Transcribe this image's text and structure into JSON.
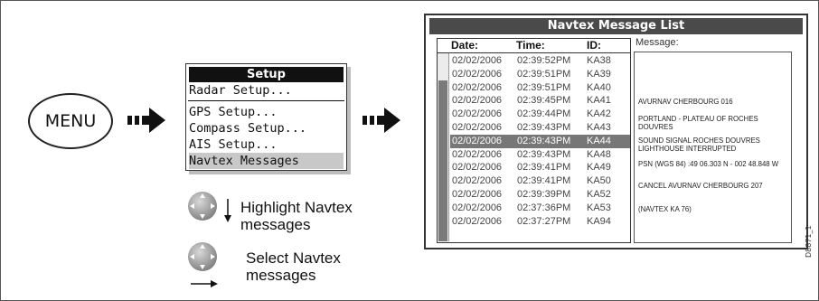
{
  "menu_key": {
    "label": "MENU"
  },
  "setup_menu": {
    "title": "Setup",
    "items": [
      {
        "label": "Radar Setup..."
      },
      {
        "label": "GPS Setup..."
      },
      {
        "label": "Compass Setup..."
      },
      {
        "label": "AIS Setup..."
      },
      {
        "label": "Navtex Messages",
        "selected": true
      }
    ]
  },
  "navtex": {
    "title": "Navtex Message List",
    "columns": {
      "date": "Date:",
      "time": "Time:",
      "id": "ID:"
    },
    "message_label": "Message:",
    "rows": [
      {
        "date": "02/02/2006",
        "time": "02:39:52PM",
        "id": "KA38"
      },
      {
        "date": "02/02/2006",
        "time": "02:39:51PM",
        "id": "KA39"
      },
      {
        "date": "02/02/2006",
        "time": "02:39:51PM",
        "id": "KA40"
      },
      {
        "date": "02/02/2006",
        "time": "02:39:45PM",
        "id": "KA41"
      },
      {
        "date": "02/02/2006",
        "time": "02:39:44PM",
        "id": "KA42"
      },
      {
        "date": "02/02/2006",
        "time": "02:39:43PM",
        "id": "KA43"
      },
      {
        "date": "02/02/2006",
        "time": "02:39:43PM",
        "id": "KA44",
        "selected": true
      },
      {
        "date": "02/02/2006",
        "time": "02:39:43PM",
        "id": "KA48"
      },
      {
        "date": "02/02/2006",
        "time": "02:39:41PM",
        "id": "KA49"
      },
      {
        "date": "02/02/2006",
        "time": "02:39:41PM",
        "id": "KA50"
      },
      {
        "date": "02/02/2006",
        "time": "02:39:39PM",
        "id": "KA52"
      },
      {
        "date": "02/02/2006",
        "time": "02:37:36PM",
        "id": "KA53"
      },
      {
        "date": "02/02/2006",
        "time": "02:37:27PM",
        "id": "KA94"
      }
    ],
    "message_lines": [
      "AVURNAV CHERBOURG 016",
      "PORTLAND - PLATEAU OF ROCHES DOUVRES",
      "SOUND SIGNAL ROCHES DOUVRES LIGHTHOUSE INTERRUPTED",
      "PSN (WGS 84) :49 06.303 N - 002 48.848 W",
      "CANCEL AVURNAV CHERBOURG 207",
      "(NAVTEX KA 76)"
    ]
  },
  "instructions": {
    "highlight": {
      "line1": "Highlight Navtex",
      "line2": "messages"
    },
    "select": {
      "line1": "Select Navtex",
      "line2": "messages"
    }
  },
  "figure_ref": "D8871_1",
  "colors": {
    "title_bar": "#4a4a4a",
    "setup_title": "#111111",
    "selected_row": "#777777",
    "selected_menu_item": "#c8c8c8",
    "knob": "#9a9a9a"
  }
}
